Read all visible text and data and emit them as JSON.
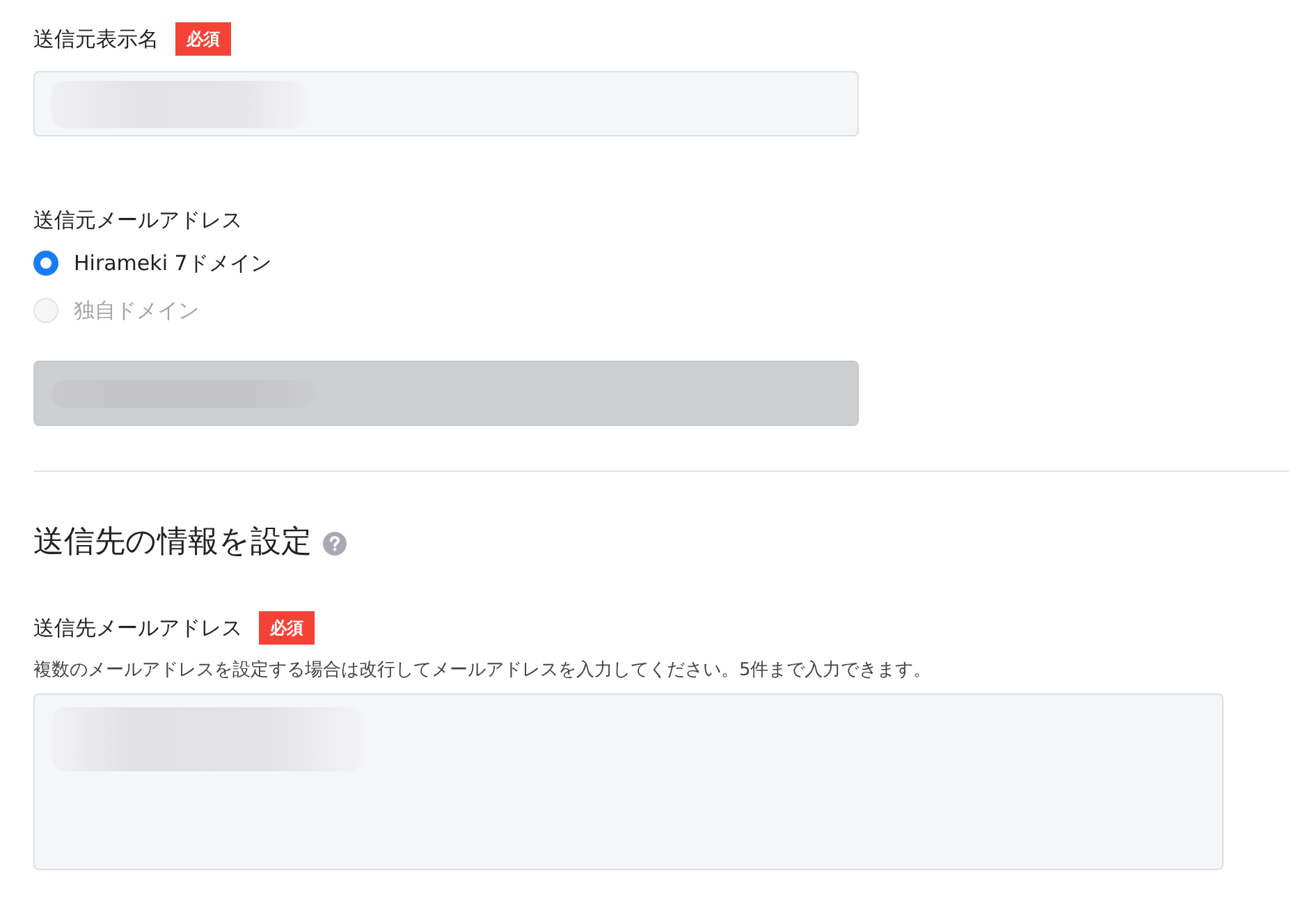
{
  "sender": {
    "display_name": {
      "label": "送信元表示名",
      "badge": "必須",
      "field": {
        "kind": "input",
        "disabled": false,
        "blurred": true
      }
    },
    "address": {
      "label": "送信元メールアドレス",
      "options": [
        {
          "label": "Hirameki 7ドメイン",
          "selected": true,
          "disabled": false
        },
        {
          "label": "独自ドメイン",
          "selected": false,
          "disabled": true
        }
      ],
      "field": {
        "kind": "input",
        "disabled": true,
        "blurred": true
      }
    }
  },
  "recipient": {
    "heading": "送信先の情報を設定",
    "address": {
      "label": "送信先メールアドレス",
      "badge": "必須",
      "hint": "複数のメールアドレスを設定する場合は改行してメールアドレスを入力してください。5件まで入力できます。",
      "field": {
        "kind": "textarea",
        "disabled": false,
        "blurred": true
      }
    }
  }
}
